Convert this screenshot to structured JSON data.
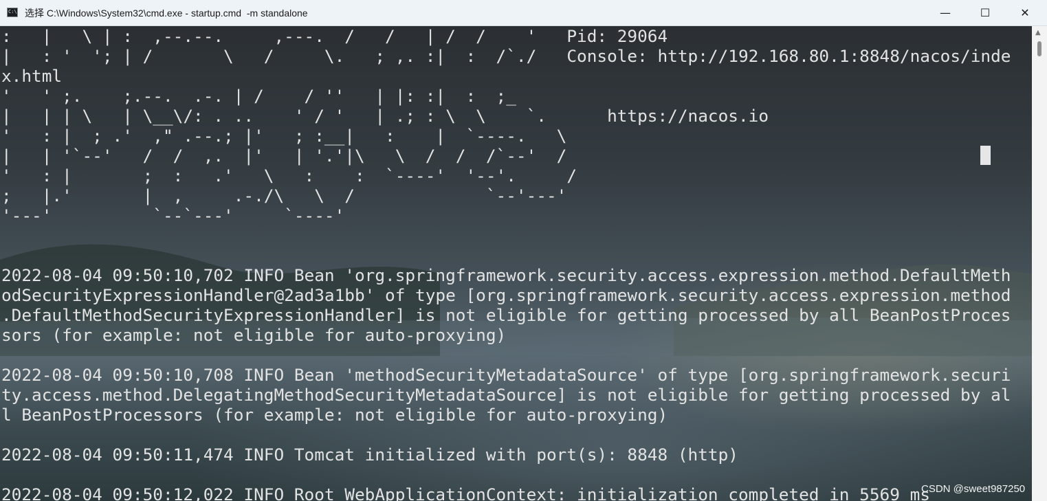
{
  "window": {
    "title": "选择 C:\\Windows\\System32\\cmd.exe - startup.cmd  -m standalone",
    "icon_text": "C:\\",
    "minimize_glyph": "—",
    "maximize_glyph": "☐",
    "close_glyph": "✕"
  },
  "terminal": {
    "lines": [
      ":   |   \\ | :  ,--.--.     ,---.  /   /   | /  /    '   Pid: 29064",
      "|   : '  '; | /       \\   /     \\.   ; ,. :|  :  /`./   Console: http://192.168.80.1:8848/nacos/inde",
      "x.html",
      "'   ' ;.    ;.--.  .-. | /    / ''   | |: :|  :  ;_",
      "|   | | \\   | \\__\\/: . ..    ' / '   | .; : \\  \\    `.      https://nacos.io",
      "'   : |  ; .'  ,\" .--.; |'   ; :__|   :    |  `----.   \\",
      "|   | '`--'   /  /  ,.  |'   | '.'|\\   \\  /  /  /`--'  /",
      "'   : |       ;  :   .'   \\   :    :  `----'  '--'.     /",
      ";   |.'       |  ,     .-./\\   \\  /             `--'---'",
      "'---'          `--`---'     `----'",
      "",
      "",
      "2022-08-04 09:50:10,702 INFO Bean 'org.springframework.security.access.expression.method.DefaultMeth",
      "odSecurityExpressionHandler@2ad3a1bb' of type [org.springframework.security.access.expression.method",
      ".DefaultMethodSecurityExpressionHandler] is not eligible for getting processed by all BeanPostProces",
      "sors (for example: not eligible for auto-proxying)",
      "",
      "2022-08-04 09:50:10,708 INFO Bean 'methodSecurityMetadataSource' of type [org.springframework.securi",
      "ty.access.method.DelegatingMethodSecurityMetadataSource] is not eligible for getting processed by al",
      "l BeanPostProcessors (for example: not eligible for auto-proxying)",
      "",
      "2022-08-04 09:50:11,474 INFO Tomcat initialized with port(s): 8848 (http)",
      "",
      "2022-08-04 09:50:12,022 INFO Root WebApplicationContext: initialization completed in 5569 ms"
    ]
  },
  "scrollbar": {
    "up_arrow": "▲"
  },
  "watermark": "CSDN @sweet987250",
  "colors": {
    "titlebar": "#eef3f8",
    "terminal_text": "#e3e3e3",
    "scrollbar": "#f3f3f3"
  }
}
